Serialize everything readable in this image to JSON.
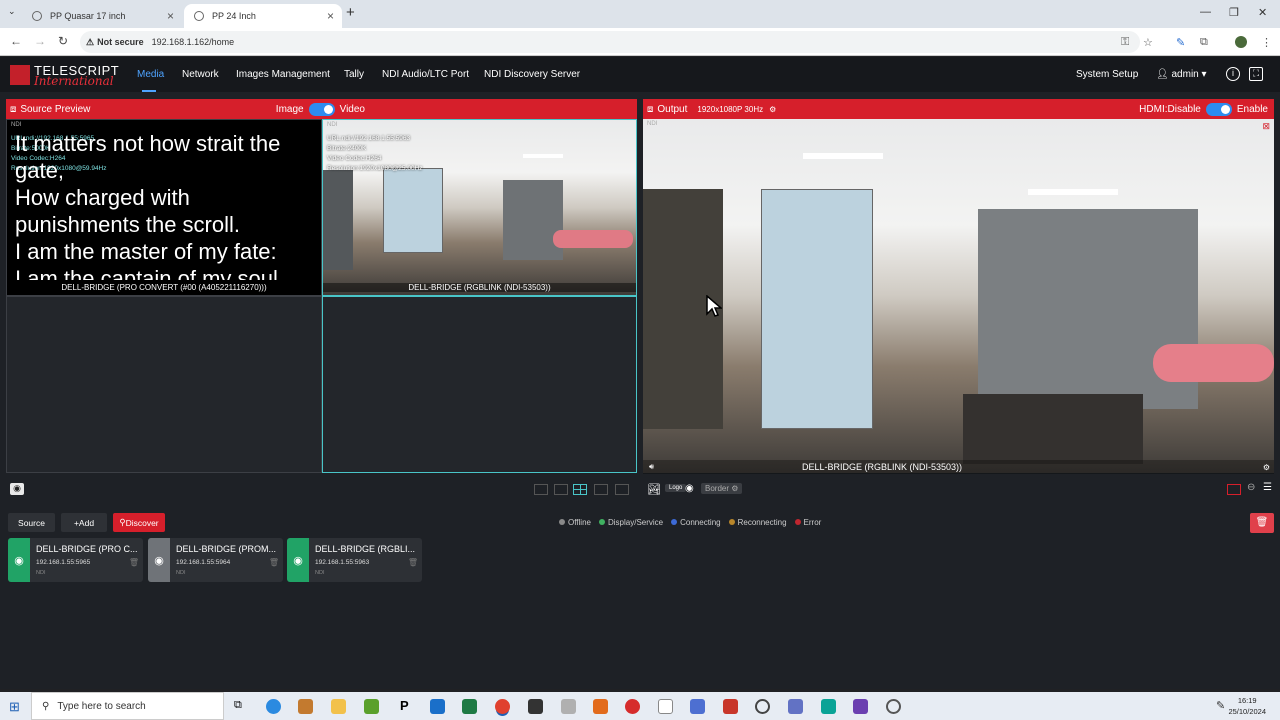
{
  "browser": {
    "tabs": [
      {
        "title": "PP Quasar 17 inch",
        "active": false
      },
      {
        "title": "PP 24 Inch",
        "active": true
      }
    ],
    "not_secure": "Not secure",
    "url": "192.168.1.162/home"
  },
  "app": {
    "logo": {
      "line1": "TELESCRIPT",
      "line2": "International"
    },
    "nav": [
      "Media",
      "Network",
      "Images Management",
      "Tally",
      "NDI Audio/LTC Port",
      "NDI Discovery Server"
    ],
    "active_nav": "Media",
    "system_setup": "System Setup",
    "user": "admin",
    "source_preview": {
      "title": "Source Preview",
      "image_label": "Image",
      "video_label": "Video",
      "cells": [
        {
          "tag": "NDI",
          "info": [
            "URL:ndi://192.168.1.55:5965",
            "Bitrate:5000K",
            "Video Codec:H264",
            "Resolution:1920x1080@59.94Hz"
          ],
          "lyric": [
            "It matters not how strait the gate,",
            "How charged with punishments the scroll.",
            "I am the master of my fate:",
            "I am the captain of my soul."
          ],
          "caption": "DELL-BRIDGE (PRO CONVERT (#00 (A405221116270)))"
        },
        {
          "tag": "NDI",
          "info": [
            "URL:ndi://192.168.1.55:5963",
            "Bitrate:2400K",
            "Video Codec:H264",
            "Resolution:1920x1080@25.00Hz"
          ],
          "caption": "DELL-BRIDGE (RGBLINK (NDI-53503))"
        }
      ]
    },
    "output": {
      "title": "Output",
      "resolution": "1920x1080P 30Hz",
      "hdmi_label": "HDMI:Disable",
      "enable_label": "Enable",
      "tag": "NDI",
      "caption": "DELL-BRIDGE (RGBLINK (NDI-53503))",
      "toolbar": {
        "logo": "Logo",
        "border": "Border"
      }
    },
    "source_bar": {
      "source_btn": "Source",
      "add_btn": "+Add",
      "discover_btn": "Discover",
      "legend": [
        {
          "label": "Offline",
          "color": "#8a8a8a"
        },
        {
          "label": "Display/Service",
          "color": "#3fb160"
        },
        {
          "label": "Connecting",
          "color": "#3d6ad6"
        },
        {
          "label": "Reconnecting",
          "color": "#b8862a"
        },
        {
          "label": "Error",
          "color": "#c0262f"
        }
      ]
    },
    "source_cards": [
      {
        "name": "DELL-BRIDGE (PRO C...",
        "ip": "192.168.1.55:5965",
        "type": "NDI",
        "color": "#21a366"
      },
      {
        "name": "DELL-BRIDGE (PROM...",
        "ip": "192.168.1.55:5964",
        "type": "NDI",
        "color": "#6f7378"
      },
      {
        "name": "DELL-BRIDGE (RGBLI...",
        "ip": "192.168.1.55:5963",
        "type": "NDI",
        "color": "#21a366"
      }
    ]
  },
  "taskbar": {
    "search_placeholder": "Type here to search",
    "time": "16:19",
    "date": "25/10/2024"
  }
}
